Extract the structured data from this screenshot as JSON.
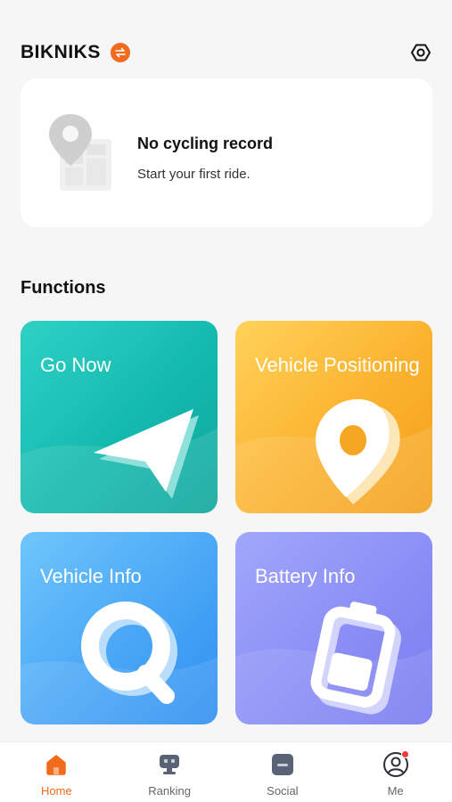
{
  "header": {
    "brand": "BIKNIKS",
    "switch_icon": "swap-icon",
    "settings_icon": "settings-hex-icon"
  },
  "record_card": {
    "title": "No cycling record",
    "subtitle": "Start your first ride.",
    "illustration": "map-pin-illustration"
  },
  "functions": {
    "title": "Functions",
    "tiles": [
      {
        "label": "Go Now",
        "icon": "navigation-arrow-icon",
        "color": "#14b9ae"
      },
      {
        "label": "Vehicle Positioning",
        "icon": "location-pin-icon",
        "color": "#fbb22e"
      },
      {
        "label": "Vehicle Info",
        "icon": "search-q-icon",
        "color": "#4aa7f6"
      },
      {
        "label": "Battery Info",
        "icon": "battery-icon",
        "color": "#8b8ef5"
      }
    ]
  },
  "tabbar": {
    "items": [
      {
        "label": "Home",
        "icon": "home-icon",
        "active": true
      },
      {
        "label": "Ranking",
        "icon": "ranking-icon",
        "active": false
      },
      {
        "label": "Social",
        "icon": "social-icon",
        "active": false
      },
      {
        "label": "Me",
        "icon": "profile-icon",
        "active": false
      }
    ]
  },
  "colors": {
    "accent": "#f26a1b",
    "notification_dot": "#ef3b3b"
  }
}
